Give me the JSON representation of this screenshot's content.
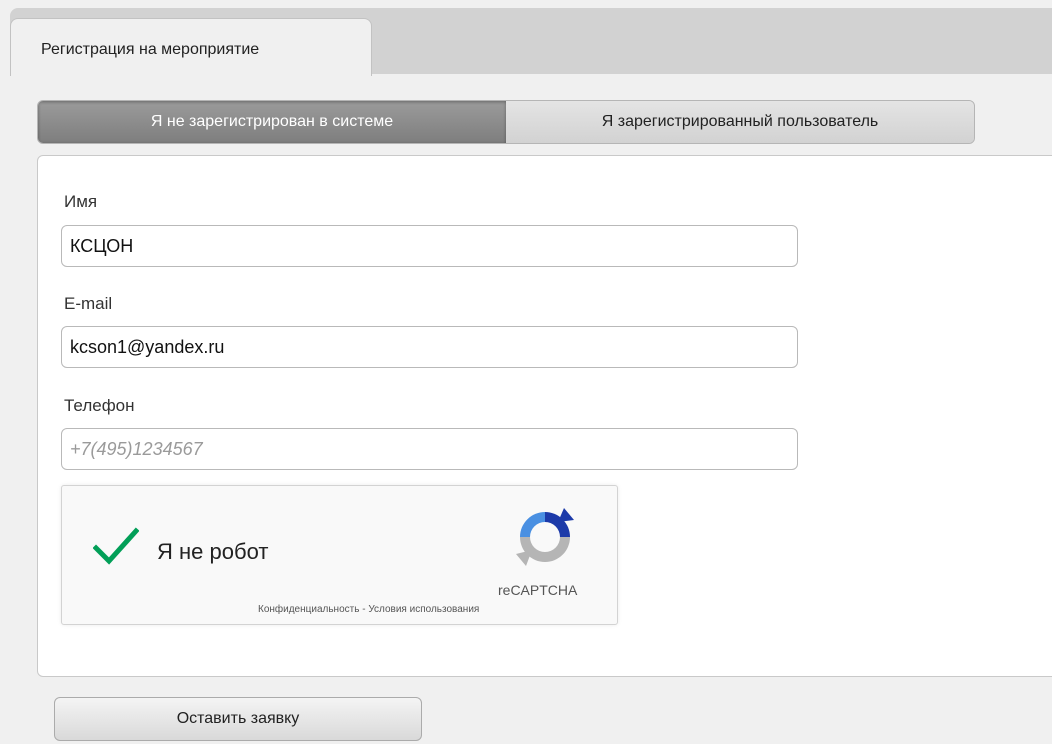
{
  "tab": {
    "title": "Регистрация на мероприятие"
  },
  "segment": {
    "unregistered": "Я не зарегистрирован в системе",
    "registered": "Я зарегистрированный пользователь"
  },
  "form": {
    "name_label": "Имя",
    "name_value": "КСЦОН",
    "email_label": "E-mail",
    "email_value": "kcson1@yandex.ru",
    "phone_label": "Телефон",
    "phone_value": "",
    "phone_placeholder": "+7(495)1234567"
  },
  "captcha": {
    "label": "Я не робот",
    "brand": "reCAPTCHA",
    "privacy": "Конфиденциальность",
    "separator": "-",
    "terms": "Условия использования",
    "check_icon": "checkmark-icon",
    "logo_icon": "recaptcha-logo-icon"
  },
  "submit": {
    "label": "Оставить заявку"
  },
  "colors": {
    "check": "#029f58",
    "recaptcha_blue": "#1c3aa9",
    "recaptcha_light": "#4a90e2",
    "recaptcha_gray": "#b5b5b5"
  }
}
